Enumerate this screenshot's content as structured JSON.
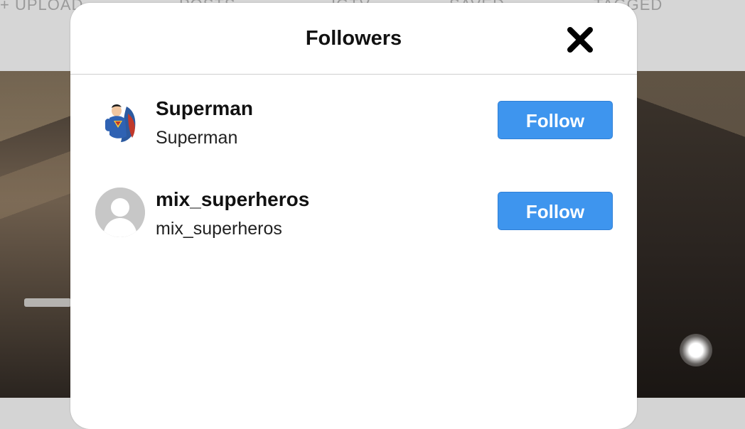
{
  "background": {
    "nav_items": [
      "+ UPLOAD",
      "POSTS",
      "IGTV",
      "SAVED",
      "TAGGED"
    ]
  },
  "modal": {
    "title": "Followers",
    "close_icon": "close-icon"
  },
  "followers": [
    {
      "username": "Superman",
      "full_name": "Superman",
      "button_label": "Follow",
      "avatar": "superman-avatar"
    },
    {
      "username": "mix_superheros",
      "full_name": "mix_superheros",
      "button_label": "Follow",
      "avatar": "default-avatar"
    }
  ],
  "colors": {
    "follow_button": "#3e95ee",
    "modal_background": "#ffffff",
    "overlay": "#d6d6d6"
  }
}
